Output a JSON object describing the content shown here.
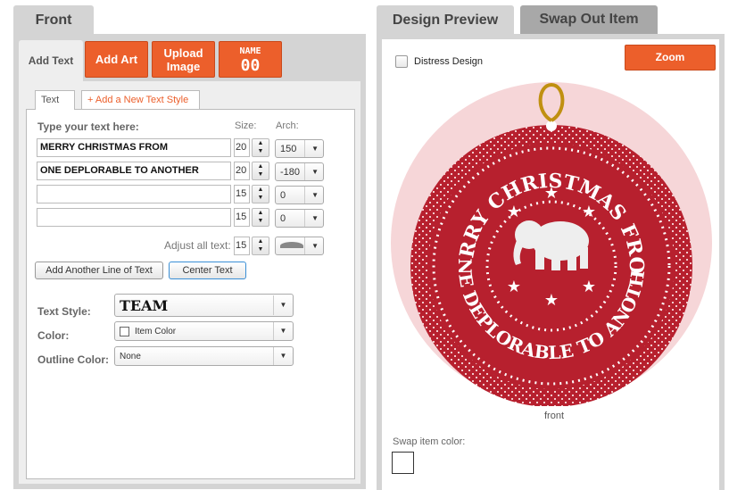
{
  "left": {
    "front_tab": "Front",
    "add_text_tab": "Add Text",
    "add_art": "Add Art",
    "upload_image": [
      "Upload",
      "Image"
    ],
    "name_button": [
      "NAME",
      "00"
    ],
    "subtabs": {
      "text": "Text",
      "add_style": "+ Add a New Text Style"
    },
    "type_label": "Type your text here:",
    "size_label": "Size:",
    "arch_label": "Arch:",
    "lines": [
      {
        "text": "MERRY CHRISTMAS FROM",
        "size": "20",
        "arch": "150"
      },
      {
        "text": "ONE DEPLORABLE TO ANOTHER",
        "size": "20",
        "arch": "-180"
      },
      {
        "text": "",
        "size": "15",
        "arch": "0"
      },
      {
        "text": "",
        "size": "15",
        "arch": "0"
      }
    ],
    "adjust_label": "Adjust all text:",
    "adjust_size": "15",
    "add_line": "Add Another Line of Text",
    "center_text": "Center Text",
    "text_style_label": "Text Style:",
    "text_style": "TEAM",
    "color_label": "Color:",
    "color": "Item Color",
    "outline_label": "Outline Color:",
    "outline": "None"
  },
  "right": {
    "design_preview_tab": "Design Preview",
    "swap_tab": "Swap Out Item",
    "distress": "Distress Design",
    "distress_checked": false,
    "zoom": "Zoom",
    "ornament": {
      "top_text": "MERRY CHRISTMAS FROM",
      "bottom_text": "ONE DEPLORABLE TO ANOTHER",
      "red": "#b7202e",
      "pink": "#f6d6d8"
    },
    "side_label": "front",
    "swap_color_label": "Swap item color:",
    "swap_color": "#ffffff"
  },
  "colors": {
    "accent": "#ec5f2b"
  }
}
